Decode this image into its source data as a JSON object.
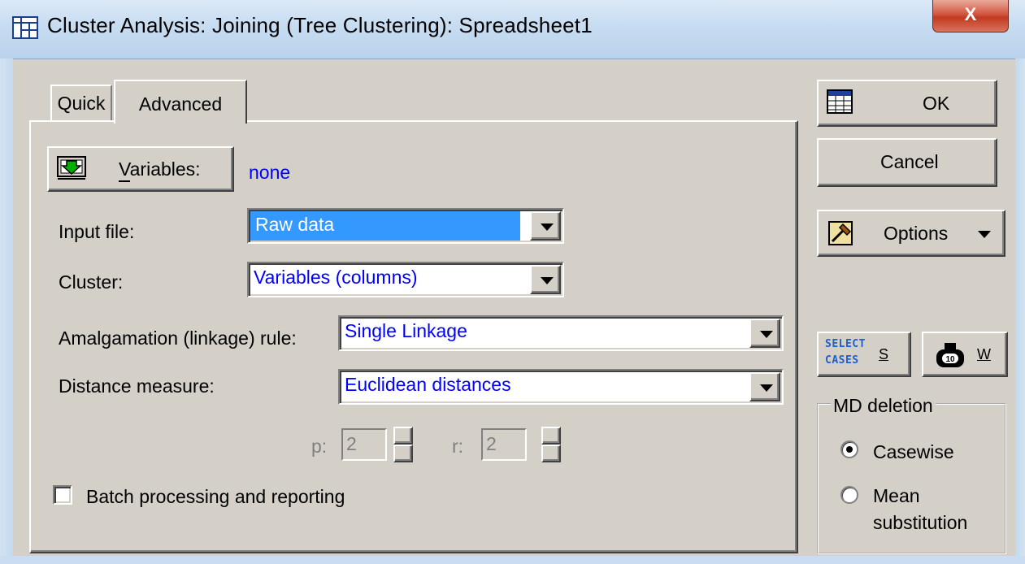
{
  "window": {
    "title": "Cluster Analysis: Joining (Tree Clustering): Spreadsheet1",
    "close_label": "X"
  },
  "tabs": [
    {
      "label": "Quick"
    },
    {
      "label": "Advanced"
    }
  ],
  "variables": {
    "button_label": "Variables:",
    "value": "none"
  },
  "form": {
    "input_file": {
      "label": "Input file:",
      "value": "Raw data"
    },
    "cluster": {
      "label": "Cluster:",
      "value": "Variables (columns)"
    },
    "amalgamation": {
      "label": "Amalgamation (linkage) rule:",
      "value": "Single Linkage"
    },
    "distance": {
      "label": "Distance measure:",
      "value": "Euclidean distances"
    },
    "p": {
      "label": "p:",
      "value": "2"
    },
    "r": {
      "label": "r:",
      "value": "2"
    },
    "batch": {
      "label": "Batch processing and reporting",
      "checked": false
    }
  },
  "buttons": {
    "ok": "OK",
    "cancel": "Cancel",
    "options": "Options",
    "select_cases_line1": "SELECT",
    "select_cases_line2": "CASES",
    "select_cases_key": "S",
    "weight_key": "W"
  },
  "md_deletion": {
    "title": "MD deletion",
    "options": [
      {
        "label": "Casewise",
        "selected": true
      },
      {
        "label": "Mean",
        "label2": "substitution",
        "selected": false
      }
    ]
  }
}
